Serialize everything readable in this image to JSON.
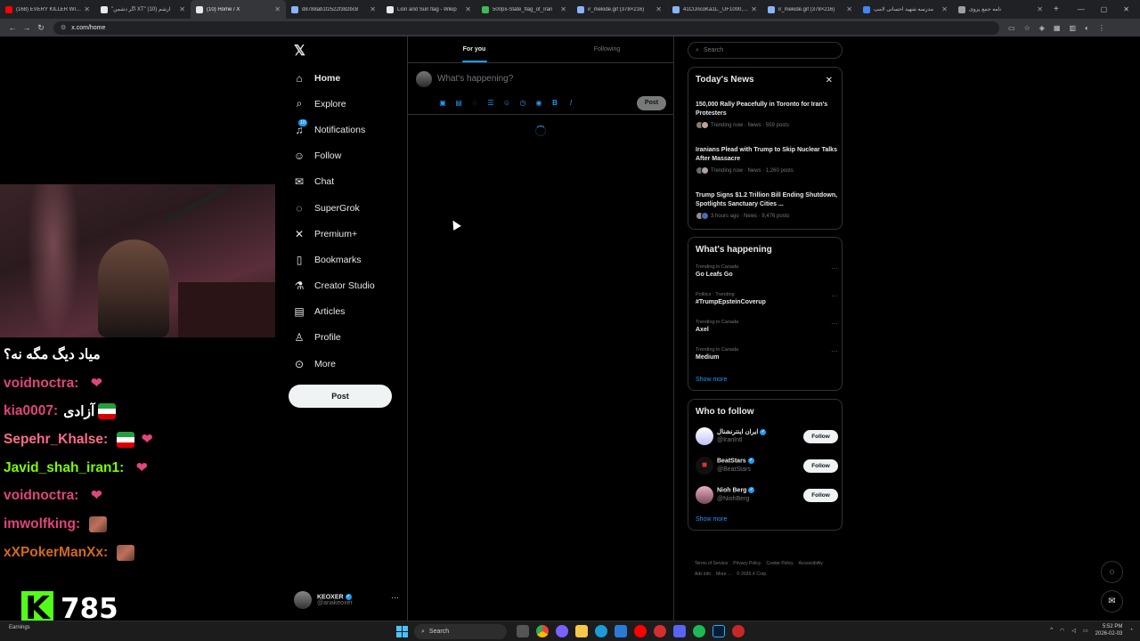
{
  "browser": {
    "tabs": [
      {
        "label": "(168) EVERY KILLER WINS",
        "color": "#ff0000"
      },
      {
        "label": "\"اگر دشمن XT\" آرشم (10)",
        "color": "#e7e9ea"
      },
      {
        "label": "(10) Home / X",
        "color": "#e7e9ea",
        "active": true
      },
      {
        "label": "d8788ab1f2522f382bc8",
        "color": "#8ab4f8"
      },
      {
        "label": "Lion and Sun flag - Wikip",
        "color": "#e7e9ea"
      },
      {
        "label": "500px-State_flag_of_Iran",
        "color": "#3cba54"
      },
      {
        "label": "ir_mekide.gif (378×216)",
        "color": "#8ab4f8"
      },
      {
        "label": "41CUncoKa1L._UF1000,10",
        "color": "#8ab4f8"
      },
      {
        "label": "ir_mekide.gif (378×216)",
        "color": "#8ab4f8"
      },
      {
        "label": "مدرسه شهید احسانی لامپ",
        "color": "#4285f4"
      },
      {
        "label": "نامه جمع پزوی",
        "color": "#9aa0a6"
      }
    ],
    "url": "x.com/home"
  },
  "stream": {
    "caption": "میاد دیگ مگه نه؟",
    "chat": [
      {
        "user": "voidnoctra:",
        "text": "",
        "color": "#e0457b",
        "emote": "heart"
      },
      {
        "user": "kia0007:",
        "text": "آزادی",
        "color": "#e0457b",
        "emote": "flag"
      },
      {
        "user": "Sepehr_Khalse:",
        "text": "",
        "color": "#ff6b8a",
        "emote": "flag heart"
      },
      {
        "user": "Javid_shah_iran1:",
        "text": "",
        "color": "#7cfc00",
        "emote": "heart"
      },
      {
        "user": "voidnoctra:",
        "text": "",
        "color": "#e0457b",
        "emote": "heart"
      },
      {
        "user": "imwolfking:",
        "text": "",
        "color": "#e0457b",
        "emote": "img"
      },
      {
        "user": "xXPokerManXx:",
        "text": "",
        "color": "#d2691e",
        "emote": "img"
      }
    ],
    "viewers": "785"
  },
  "nav": {
    "items": [
      {
        "label": "Home",
        "icon": "home-icon",
        "glyph": "⌂"
      },
      {
        "label": "Explore",
        "icon": "search-icon",
        "glyph": "⌕"
      },
      {
        "label": "Notifications",
        "icon": "bell-icon",
        "glyph": "♫",
        "badge": "10"
      },
      {
        "label": "Follow",
        "icon": "person-add-icon",
        "glyph": "☺"
      },
      {
        "label": "Chat",
        "icon": "mail-icon",
        "glyph": "✉"
      },
      {
        "label": "SuperGrok",
        "icon": "grok-icon",
        "glyph": "◌"
      },
      {
        "label": "Premium+",
        "icon": "x-icon",
        "glyph": "✕"
      },
      {
        "label": "Bookmarks",
        "icon": "bookmark-icon",
        "glyph": "▯"
      },
      {
        "label": "Creator Studio",
        "icon": "flask-icon",
        "glyph": "⚗"
      },
      {
        "label": "Articles",
        "icon": "article-icon",
        "glyph": "▤"
      },
      {
        "label": "Profile",
        "icon": "person-icon",
        "glyph": "♙"
      },
      {
        "label": "More",
        "icon": "more-circle-icon",
        "glyph": "⊙"
      }
    ],
    "post_label": "Post",
    "account": {
      "name": "KEOXER",
      "handle": "@ariakeoxer"
    }
  },
  "timeline": {
    "tabs": [
      "For you",
      "Following"
    ],
    "composer_placeholder": "What's happening?",
    "post_label": "Post"
  },
  "right": {
    "search_placeholder": "Search",
    "news": {
      "title": "Today's News",
      "items": [
        {
          "title": "150,000 Rally Peacefully in Toronto for Iran's Protesters",
          "meta": "Trending now · News · 559 posts"
        },
        {
          "title": "Iranians Plead with Trump to Skip Nuclear Talks After Massacre",
          "meta": "Trending now · News · 1,260 posts"
        },
        {
          "title": "Trump Signs $1.2 Trillion Bill Ending Shutdown, Spotlights Sanctuary Cities ...",
          "meta": "3 hours ago · News · 9,476 posts"
        }
      ]
    },
    "happening": {
      "title": "What's happening",
      "items": [
        {
          "context": "Trending in Canada",
          "topic": "Go Leafs Go"
        },
        {
          "context": "Politics · Trending",
          "topic": "#TrumpEpsteinCoverup"
        },
        {
          "context": "Trending in Canada",
          "topic": "Axel"
        },
        {
          "context": "Trending in Canada",
          "topic": "Medium"
        }
      ],
      "show_more": "Show more"
    },
    "who_to_follow": {
      "title": "Who to follow",
      "items": [
        {
          "name": "ایران اینترنشنال",
          "handle": "@IranIntl",
          "button": "Follow"
        },
        {
          "name": "BeatStars",
          "handle": "@BeatStars",
          "button": "Follow"
        },
        {
          "name": "Nioh Berg",
          "handle": "@NiohBerg",
          "button": "Follow"
        }
      ],
      "show_more": "Show more"
    },
    "footer": [
      "Terms of Service",
      "Privacy Policy",
      "Cookie Policy",
      "Accessibility",
      "Ads info",
      "More ...",
      "© 2026 X Corp."
    ]
  },
  "taskbar": {
    "left_label": "Earnings",
    "search_label": "Search",
    "time": "5:52 PM",
    "date": "2026-02-03"
  }
}
